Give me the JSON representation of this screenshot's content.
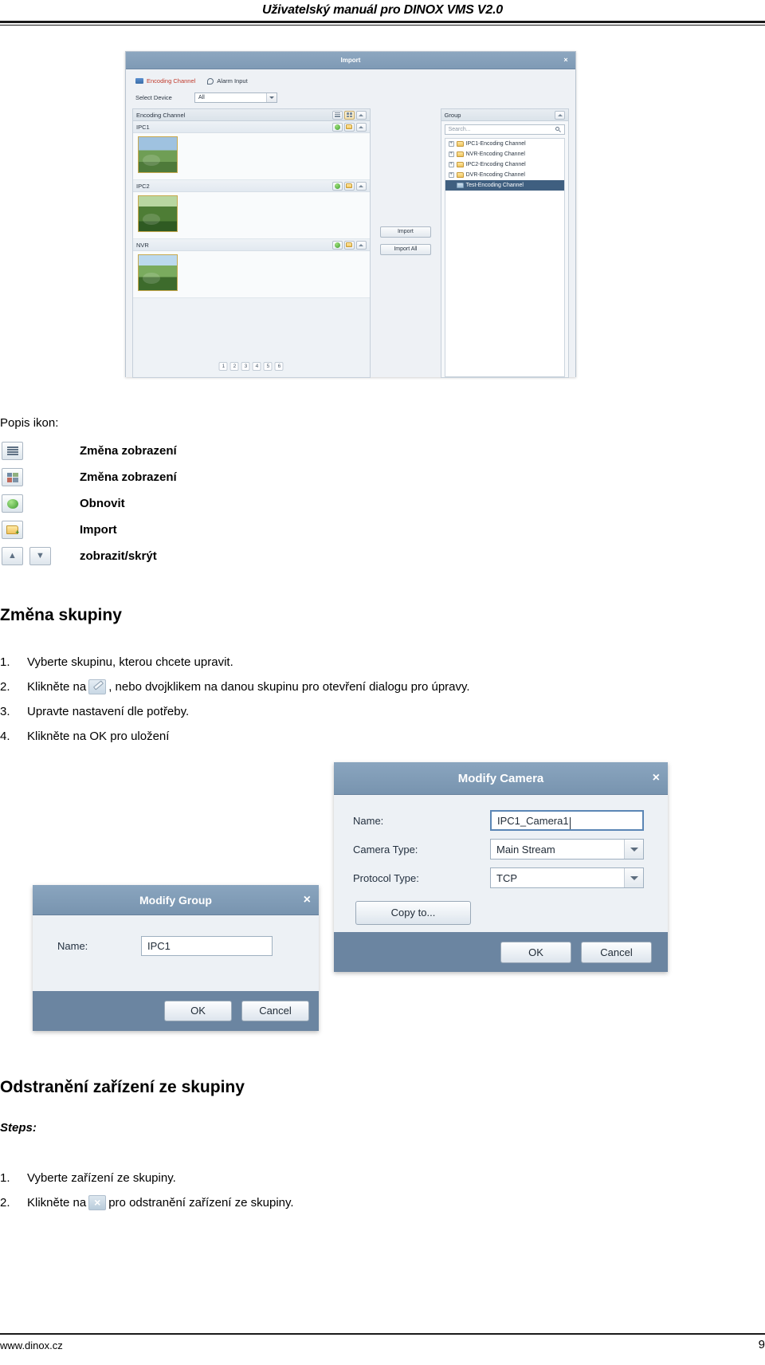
{
  "header": {
    "title": "Uživatelský manuál pro DINOX VMS V2.0"
  },
  "footer": {
    "site": "www.dinox.cz",
    "page_number": "9"
  },
  "import_dialog": {
    "title": "Import",
    "close_label": "×",
    "tabs": [
      {
        "label": "Encoding Channel",
        "icon": "chip-icon",
        "active": true
      },
      {
        "label": "Alarm Input",
        "icon": "alarm-input-icon",
        "active": false
      }
    ],
    "select_device": {
      "label": "Select Device",
      "value": "All"
    },
    "left_panel": {
      "title": "Encoding Channel",
      "devices": [
        {
          "name": "IPC1"
        },
        {
          "name": "IPC2"
        },
        {
          "name": "NVR"
        }
      ],
      "pager": [
        "1",
        "2",
        "3",
        "4",
        "5",
        "6"
      ]
    },
    "middle_buttons": [
      {
        "label": "Import"
      },
      {
        "label": "Import All"
      }
    ],
    "right_panel": {
      "title": "Group",
      "search_placeholder": "Search...",
      "items": [
        {
          "label": "IPC1-Encoding Channel",
          "expandable": true,
          "selected": false
        },
        {
          "label": "NVR-Encoding Channel",
          "expandable": true,
          "selected": false
        },
        {
          "label": "IPC2-Encoding Channel",
          "expandable": true,
          "selected": false
        },
        {
          "label": "DVR-Encoding Channel",
          "expandable": true,
          "selected": false
        },
        {
          "label": "Test-Encoding Channel",
          "expandable": false,
          "selected": true
        }
      ]
    }
  },
  "icon_legend": {
    "heading": "Popis ikon:",
    "rows": [
      {
        "label": "Změna zobrazení",
        "icons": [
          "list-view-icon"
        ]
      },
      {
        "label": "Změna zobrazení",
        "icons": [
          "grid-view-icon"
        ]
      },
      {
        "label": "Obnovit",
        "icons": [
          "refresh-icon"
        ]
      },
      {
        "label": "Import",
        "icons": [
          "import-folder-icon"
        ]
      },
      {
        "label": "zobrazit/skrýt",
        "icons": [
          "chevron-up-icon",
          "chevron-down-icon"
        ]
      }
    ]
  },
  "section_change_group": {
    "heading": "Změna skupiny",
    "steps": [
      {
        "num": "1.",
        "text_before": "Vyberte skupinu, kterou chcete upravit.",
        "icon": null,
        "text_after": ""
      },
      {
        "num": "2.",
        "text_before": "Klikněte na",
        "icon": "edit-pencil-icon",
        "text_after": ", nebo dvojklikem na danou skupinu pro otevření dialogu pro úpravy."
      },
      {
        "num": "3.",
        "text_before": "Upravte nastavení dle potřeby.",
        "icon": null,
        "text_after": ""
      },
      {
        "num": "4.",
        "text_before": "Klikněte na OK pro uložení",
        "icon": null,
        "text_after": ""
      }
    ]
  },
  "modify_camera_dialog": {
    "title": "Modify Camera",
    "close_label": "×",
    "fields": [
      {
        "label": "Name:",
        "value": "IPC1_Camera1",
        "type": "text"
      },
      {
        "label": "Camera Type:",
        "value": "Main Stream",
        "type": "select"
      },
      {
        "label": "Protocol Type:",
        "value": "TCP",
        "type": "select"
      }
    ],
    "copy_to_label": "Copy to...",
    "ok_label": "OK",
    "cancel_label": "Cancel"
  },
  "modify_group_dialog": {
    "title": "Modify Group",
    "close_label": "×",
    "field": {
      "label": "Name:",
      "value": "IPC1"
    },
    "ok_label": "OK",
    "cancel_label": "Cancel"
  },
  "section_remove_device": {
    "heading": "Odstranění zařízení ze skupiny",
    "steps_label": "Steps:",
    "steps": [
      {
        "num": "1.",
        "text_before": "Vyberte zařízení ze skupiny.",
        "icon": null,
        "text_after": ""
      },
      {
        "num": "2.",
        "text_before": "Klikněte na",
        "icon": "delete-x-icon",
        "text_after": "pro odstranění zařízení ze skupiny."
      }
    ]
  }
}
